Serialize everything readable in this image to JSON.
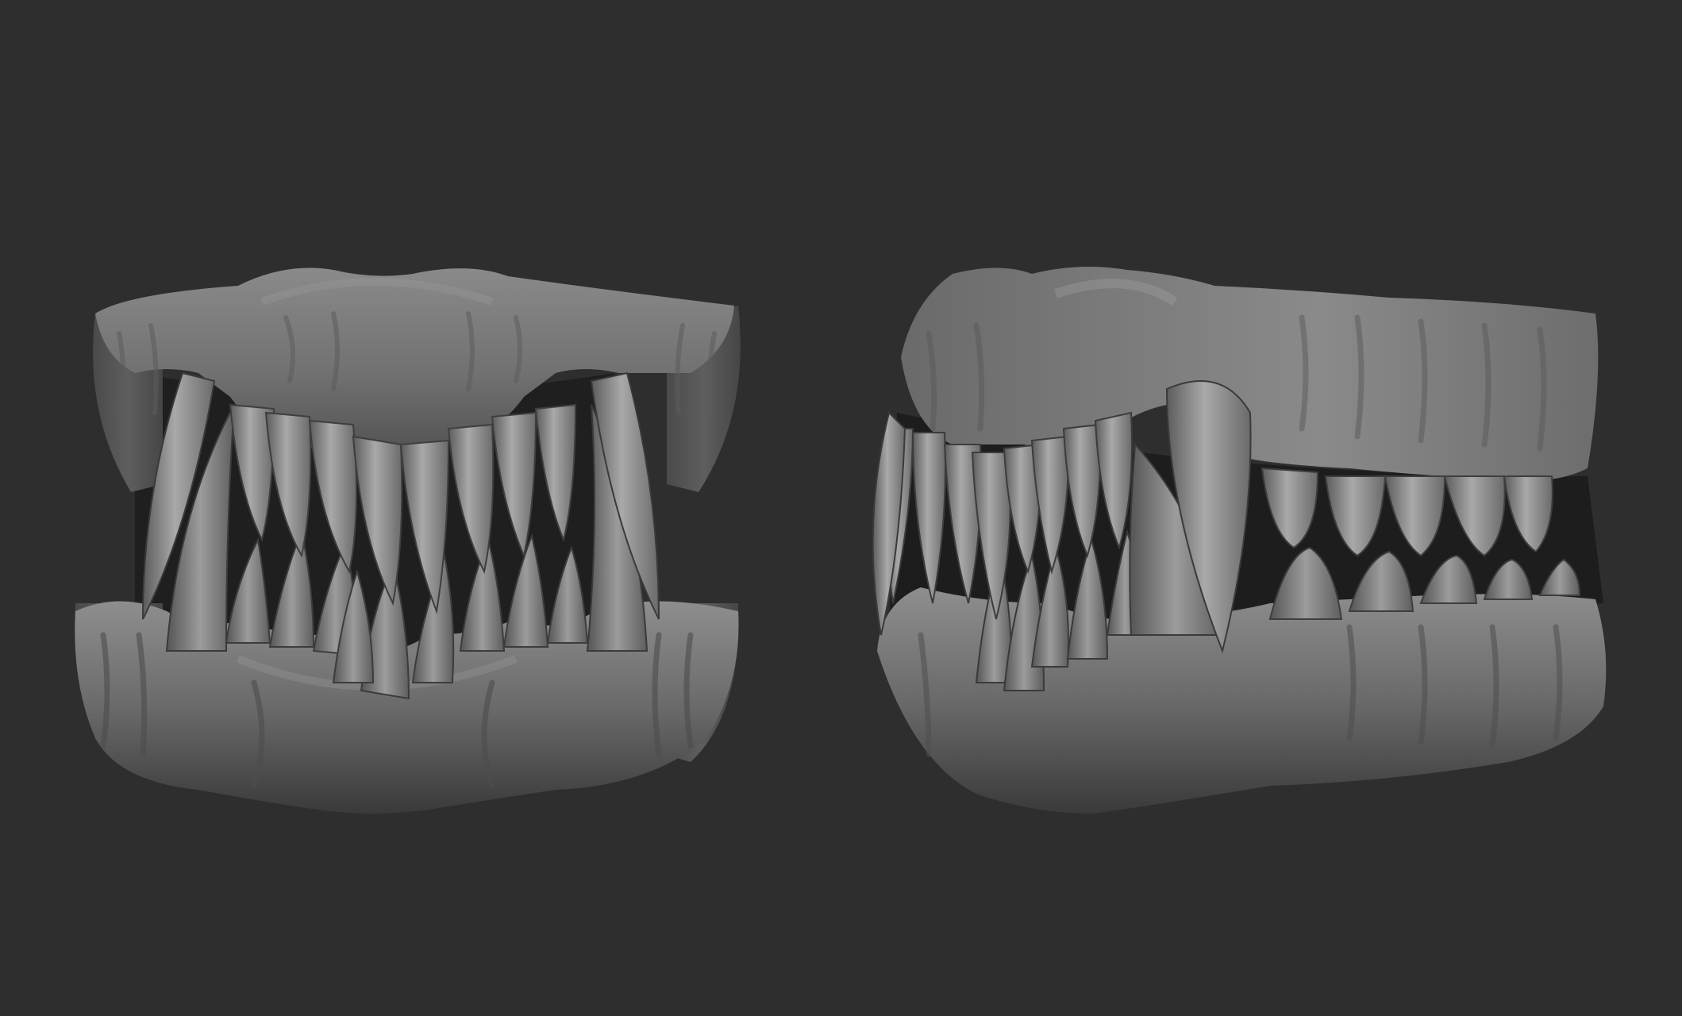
{
  "scene": {
    "background_color": "#2e2e2f",
    "material_colors": {
      "gum_light": "#8f8f8f",
      "gum_mid": "#6c6c6c",
      "gum_dark": "#3e3e3e",
      "tooth_light": "#a8a8a8",
      "tooth_dark": "#5a5a5a"
    },
    "objects": [
      {
        "kind": "render",
        "icon": "jaw-sculpt-front-view-icon"
      },
      {
        "kind": "render",
        "icon": "jaw-sculpt-three-quarter-view-icon"
      }
    ]
  }
}
